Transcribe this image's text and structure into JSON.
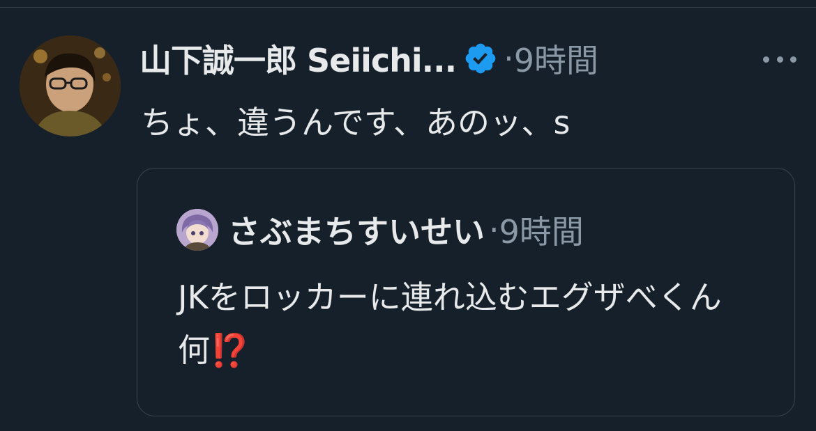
{
  "tweet": {
    "author_name": "山下誠一郎 Seiichi...",
    "verified": true,
    "time_separator": "·",
    "time": "9時間",
    "text": "ちょ、違うんです、あのッ、s"
  },
  "quoted_tweet": {
    "author_name": "さぶまちすいせい",
    "time_separator": "·",
    "time": "9時間",
    "text": "JKをロッカーに連れ込むエグザべくん何",
    "emoji": "⁉️"
  },
  "icons": {
    "more": "more-horizontal-icon",
    "verified": "verified-badge-icon"
  },
  "colors": {
    "background": "#15202b",
    "text": "#e7e9ea",
    "secondary": "#8b98a5",
    "border": "#38444d",
    "verified": "#1d9bf0",
    "emoji": "#e0245e"
  }
}
